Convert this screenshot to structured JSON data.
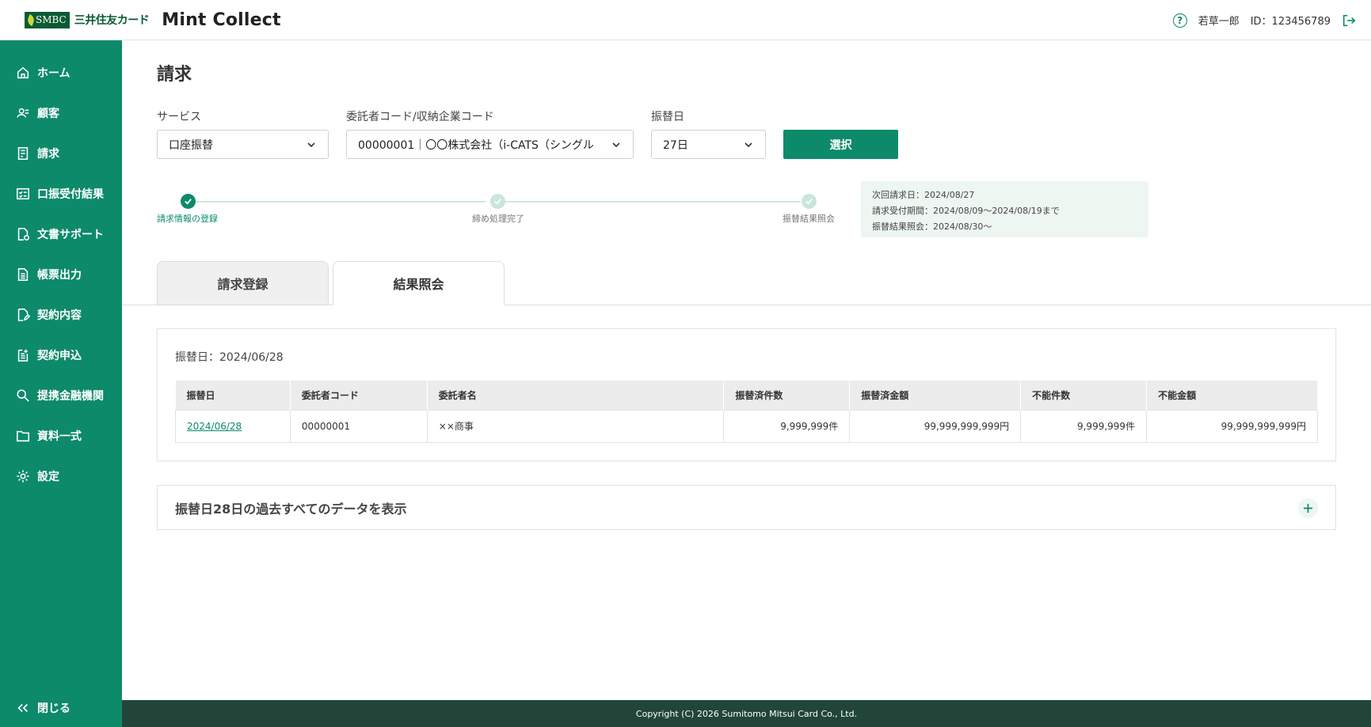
{
  "header": {
    "logo_badge": "SMBC",
    "logo_jp": "三井住友カード",
    "app_title": "Mint Collect",
    "user_name": "若草一郎",
    "user_id": "ID：123456789"
  },
  "sidebar": {
    "items": [
      {
        "label": "ホーム",
        "icon": "home-icon"
      },
      {
        "label": "顧客",
        "icon": "users-icon"
      },
      {
        "label": "請求",
        "icon": "invoice-icon"
      },
      {
        "label": "口振受付結果",
        "icon": "checklist-icon"
      },
      {
        "label": "文書サポート",
        "icon": "document-gear-icon"
      },
      {
        "label": "帳票出力",
        "icon": "report-icon"
      },
      {
        "label": "契約内容",
        "icon": "contract-edit-icon"
      },
      {
        "label": "契約申込",
        "icon": "application-icon"
      },
      {
        "label": "提携金融機関",
        "icon": "search-icon"
      },
      {
        "label": "資料一式",
        "icon": "folder-icon"
      },
      {
        "label": "設定",
        "icon": "gear-icon"
      }
    ],
    "close_label": "閉じる"
  },
  "main": {
    "title": "請求",
    "filters": {
      "service_label": "サービス",
      "service_value": "口座振替",
      "consignor_label": "委託者コード/収納企業コード",
      "consignor_value": "00000001｜〇〇株式会社（i-CATS（シングル",
      "date_label": "振替日",
      "date_value": "27日",
      "select_button": "選択"
    },
    "stepper": {
      "steps": [
        "請求情報の登録",
        "締め処理完了",
        "振替結果照会"
      ],
      "current_step": 1
    },
    "info": {
      "line1": "次回請求日：2024/08/27",
      "line2": "請求受付期間：2024/08/09〜2024/08/19まで",
      "line3": "振替結果照会：2024/08/30〜"
    },
    "tabs": [
      "請求登録",
      "結果照会"
    ],
    "active_tab": "結果照会",
    "result": {
      "date_heading": "振替日：2024/06/28",
      "columns": [
        "振替日",
        "委託者コード",
        "委託者名",
        "振替済件数",
        "振替済金額",
        "不能件数",
        "不能金額"
      ],
      "rows": [
        [
          "2024/06/28",
          "00000001",
          "××商事",
          "9,999,999件",
          "99,999,999,999円",
          "9,999,999件",
          "99,999,999,999円"
        ]
      ]
    },
    "accordion_title": "振替日28日の過去すべてのデータを表示"
  },
  "footer": {
    "copyright": "Copyright (C) 2026 Sumitomo Mitsui Card Co., Ltd."
  },
  "colors": {
    "brand_green": "#0d8a6a",
    "footer_green": "#22453a",
    "logo_green": "#0a5b34"
  }
}
